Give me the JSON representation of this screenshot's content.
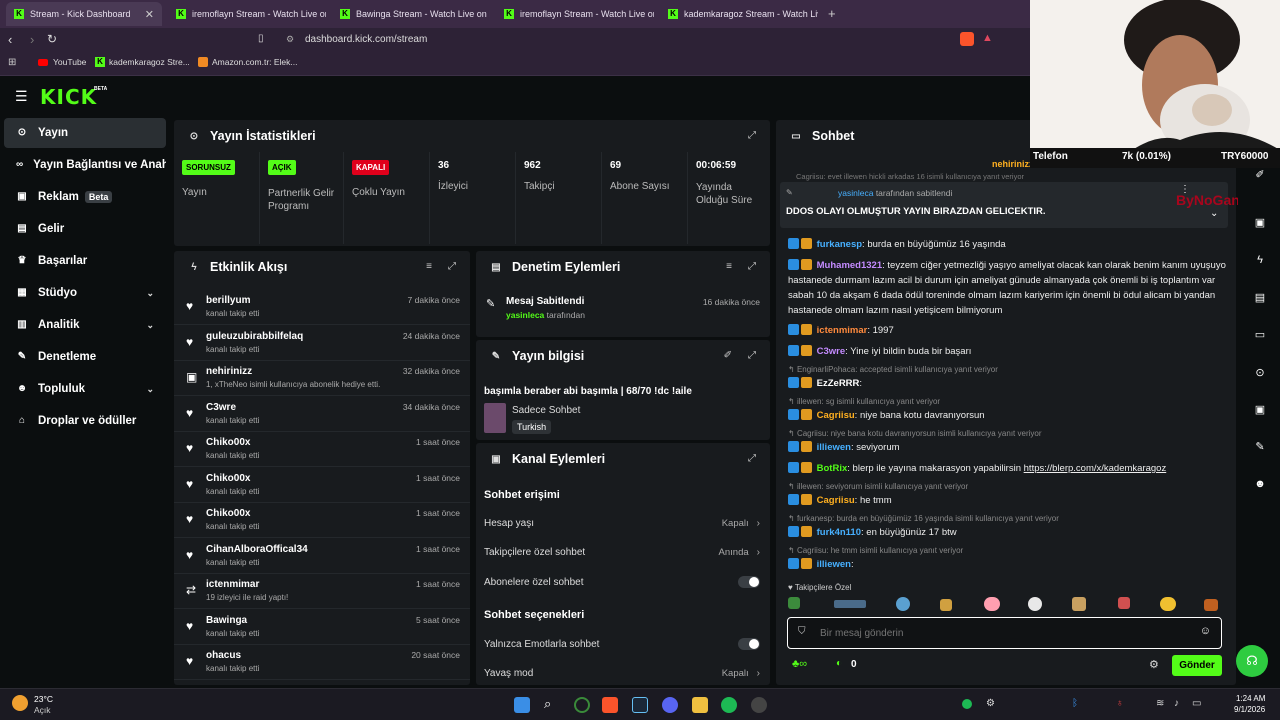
{
  "browser": {
    "tabs": [
      {
        "title": "Stream - Kick Dashboard"
      },
      {
        "title": "iremoflayn Stream - Watch Live on Ki"
      },
      {
        "title": "Bawinga Stream - Watch Live on Kick"
      },
      {
        "title": "iremoflayn Stream - Watch Live on Ki"
      },
      {
        "title": "kademkaragoz Stream - Watch Live o"
      }
    ],
    "url": "dashboard.kick.com/stream",
    "bookmarks": [
      "YouTube",
      "kademkaragoz Stre...",
      "Amazon.com.tr: Elek..."
    ]
  },
  "kick": {
    "logo": "KICK",
    "beta": "BETA"
  },
  "sidebar": {
    "items": [
      {
        "label": "Yayın",
        "icon": "broadcast-icon"
      },
      {
        "label": "Yayın Bağlantısı ve Anahtar",
        "icon": "link-icon"
      },
      {
        "label": "Reklam",
        "icon": "ad-icon",
        "badge": "Beta"
      },
      {
        "label": "Gelir",
        "icon": "money-icon"
      },
      {
        "label": "Başarılar",
        "icon": "trophy-icon"
      },
      {
        "label": "Stüdyo",
        "icon": "studio-icon"
      },
      {
        "label": "Analitik",
        "icon": "analytics-icon"
      },
      {
        "label": "Denetleme",
        "icon": "wrench-icon"
      },
      {
        "label": "Topluluk",
        "icon": "community-icon"
      },
      {
        "label": "Droplar ve ödüller",
        "icon": "gift-icon"
      }
    ]
  },
  "stats": {
    "title": "Yayın İstatistikleri",
    "cells": [
      {
        "badge": "SORUNSUZ",
        "label": "Yayın",
        "color": "#53fc18"
      },
      {
        "badge": "AÇIK",
        "label": "Partnerlik Gelir Programı",
        "color": "#53fc18"
      },
      {
        "badge": "KAPALI",
        "label": "Çoklu Yayın",
        "color": "#e0001b"
      },
      {
        "value": "36",
        "label": "İzleyici"
      },
      {
        "value": "962",
        "label": "Takipçi"
      },
      {
        "value": "69",
        "label": "Abone Sayısı"
      },
      {
        "value": "00:06:59",
        "label": "Yayında Olduğu Süre"
      }
    ]
  },
  "activity": {
    "title": "Etkinlik Akışı",
    "rows": [
      {
        "name": "berillyum",
        "sub": "kanalı takip etti",
        "time": "7 dakika önce"
      },
      {
        "name": "guleuzubirabbilfelaq",
        "sub": "kanalı takip etti",
        "time": "24 dakika önce"
      },
      {
        "name": "nehirinizz",
        "sub": "1, xTheNeo isimli kullanıcıya abonelik hediye etti.",
        "time": "32 dakika önce"
      },
      {
        "name": "C3wre",
        "sub": "kanalı takip etti",
        "time": "34 dakika önce"
      },
      {
        "name": "Chiko00x",
        "sub": "kanalı takip etti",
        "time": "1 saat önce"
      },
      {
        "name": "Chiko00x",
        "sub": "kanalı takip etti",
        "time": "1 saat önce"
      },
      {
        "name": "Chiko00x",
        "sub": "kanalı takip etti",
        "time": "1 saat önce"
      },
      {
        "name": "CihanAlboraOffical34",
        "sub": "kanalı takip etti",
        "time": "1 saat önce"
      },
      {
        "name": "ictenmimar",
        "sub": "19 izleyici ile raid yaptı!",
        "time": "1 saat önce"
      },
      {
        "name": "Bawinga",
        "sub": "kanalı takip etti",
        "time": "5 saat önce"
      },
      {
        "name": "ohacus",
        "sub": "kanalı takip etti",
        "time": "20 saat önce"
      }
    ]
  },
  "moderation": {
    "title": "Denetim Eylemleri",
    "action": "Mesaj Sabitlendi",
    "by_user": "yasinleca",
    "by_suffix": "tarafından",
    "time": "16 dakika önce"
  },
  "streaminfo": {
    "title": "Yayın bilgisi",
    "stream_title": "başımla beraber abi başımla | 68/70 !dc !aile",
    "category": "Sadece Sohbet",
    "language": "Turkish"
  },
  "channel": {
    "title": "Kanal Eylemleri",
    "section1": "Sohbet erişimi",
    "rows": [
      {
        "label": "Hesap yaşı",
        "value": "Kapalı"
      },
      {
        "label": "Takipçilere özel sohbet",
        "value": "Anında"
      },
      {
        "label": "Abonelere özel sohbet",
        "value": ""
      }
    ],
    "section2": "Sohbet seçenekleri",
    "rows2": [
      {
        "label": "Yalnızca Emotlarla sohbet",
        "value": ""
      },
      {
        "label": "Yavaş mod",
        "value": "Kapalı"
      }
    ]
  },
  "chat": {
    "title": "Sohbet",
    "top_hidden": "Cagriisu: evet illewen hickli arkadas 16 isimli kullanıcıya yanıt veriyor",
    "top_user": "nehirinizz",
    "pinned_by": "yasinleca",
    "pinned_suffix": "tarafından sabitlendi",
    "pinned_msg": "DDOS OLAYI OLMUŞTUR YAYIN BIRAZDAN GELICEKTIR.",
    "watermark": "ByNoGane",
    "messages": [
      {
        "reply": "",
        "user": "furkanesp",
        "color": "#47b0ff",
        "text": "burda en büyüğümüz 16 yaşında"
      },
      {
        "reply": "",
        "user": "Muhamed1321",
        "color": "#c48bff",
        "text": "teyzem ciğer yetmezliği yaşıyo ameliyat olacak kan olarak benim kanım uyuşuyo hastanede durmam lazım acil bi durum için ameliyat günude almanyada çok önemli bi iş toplantım var sabah 10 da akşam 6 dada ödül toreninde olmam lazım kariyerim için önemli bi ödul alicam bi yandan hastanede olmam lazım nasıl yetişicem bilmiyorum"
      },
      {
        "reply": "",
        "user": "ictenmimar",
        "color": "#ff8a3d",
        "text": "1997"
      },
      {
        "reply": "",
        "user": "C3wre",
        "color": "#c48bff",
        "text": "Yine iyi bildin buda bir başarı"
      },
      {
        "reply": "EnginarliPohaca: accepted isimli kullanıcıya yanıt veriyor",
        "user": "EzZeRRR",
        "color": "#fff",
        "text": ""
      },
      {
        "reply": "illewen: sg isimli kullanıcıya yanıt veriyor",
        "user": "Cagriisu",
        "color": "#ffb020",
        "text": "niye bana kotu davranıyorsun"
      },
      {
        "reply": "Cagriisu: niye bana kotu davranıyorsun isimli kullanıcıya yanıt veriyor",
        "user": "illiewen",
        "color": "#47b0ff",
        "text": "seviyorum"
      },
      {
        "reply": "",
        "user": "BotRix",
        "color": "#53fc18",
        "text": "blerp ile yayına makarasyon yapabilirsin",
        "link": "https://blerp.com/x/kademkaragoz"
      },
      {
        "reply": "illewen: seviyorum isimli kullanıcıya yanıt veriyor",
        "user": "Cagriisu",
        "color": "#ffb020",
        "text": "he tmm"
      },
      {
        "reply": "furkanesp: burda en büyüğümüz 16 yaşında isimli kullanıcıya yanıt veriyor",
        "user": "furk4n110",
        "color": "#47b0ff",
        "text": "en büyüğünüz 17 btw"
      },
      {
        "reply": "Cagriisu: he tmm isimli kullanıcıya yanıt veriyor",
        "user": "illiewen",
        "color": "#47b0ff",
        "text": ""
      }
    ],
    "emote_section": "Takipçilere Özel",
    "input_placeholder": "Bir mesaj gönderin",
    "points": "0",
    "send": "Gönder"
  },
  "webcam": {
    "label": "Telefon",
    "stat": "7k (0.01%)",
    "money": "TRY60000"
  },
  "taskbar": {
    "weather_temp": "23°C",
    "weather_desc": "Açık",
    "time": "1:24 AM",
    "date": "9/1/2026"
  }
}
